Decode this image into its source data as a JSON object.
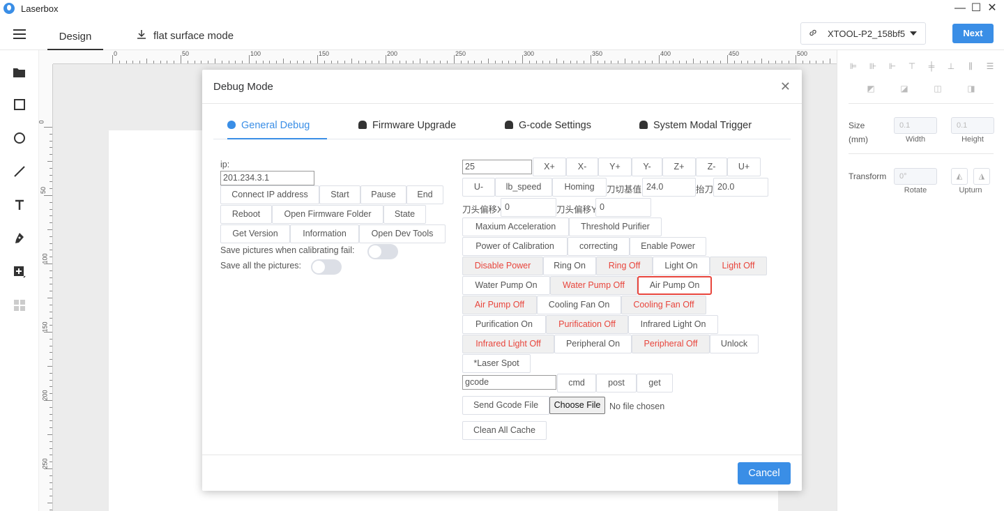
{
  "app": {
    "title": "Laserbox"
  },
  "window_controls": {
    "minimize": "—",
    "maximize": "☐",
    "close": "✕"
  },
  "topbar": {
    "tabs": [
      {
        "label": "Design"
      },
      {
        "label": "flat surface mode"
      }
    ],
    "device": {
      "name": "XTOOL-P2_158bf5"
    },
    "next_label": "Next"
  },
  "ruler": {
    "top_marks": [
      "0",
      "50",
      "100",
      "150",
      "200",
      "250",
      "300",
      "350",
      "400",
      "450",
      "500"
    ],
    "left_marks": [
      "0",
      "50",
      "100",
      "150",
      "200",
      "250"
    ]
  },
  "right_panel": {
    "size_label": "Size",
    "size_unit": "(mm)",
    "width_value": "0.1",
    "width_label": "Width",
    "height_value": "0.1",
    "height_label": "Height",
    "transform_label": "Transform",
    "rotate_value": "0°",
    "rotate_label": "Rotate",
    "upturn_label": "Upturn"
  },
  "dialog": {
    "title": "Debug Mode",
    "tabs": [
      {
        "label": "General Debug",
        "icon": "apple-icon"
      },
      {
        "label": "Firmware Upgrade",
        "icon": "android-icon"
      },
      {
        "label": "G-code Settings",
        "icon": "android-icon"
      },
      {
        "label": "System Modal Trigger",
        "icon": "android-icon"
      }
    ],
    "left": {
      "ip_label": "ip:",
      "ip_value": "201.234.3.1",
      "buttons_row1": [
        "Connect IP address",
        "Start",
        "Pause",
        "End"
      ],
      "buttons_row2": [
        "Reboot",
        "Open Firmware Folder",
        "State"
      ],
      "buttons_row3": [
        "Get Version",
        "Information",
        "Open Dev Tools"
      ],
      "save_fail_label": "Save pictures when calibrating fail:",
      "save_all_label": "Save all the pictures:"
    },
    "right": {
      "step_value": "25",
      "axis_buttons": [
        "X+",
        "X-",
        "Y+",
        "Y-",
        "Z+",
        "Z-",
        "U+"
      ],
      "row2": {
        "u_minus": "U-",
        "lb_speed": "lb_speed",
        "homing": "Homing",
        "cut_base_label": "刀切基值",
        "cut_base_value": "24.0",
        "lift_label": "抬刀",
        "lift_value": "20.0"
      },
      "offset": {
        "x_label": "刀头偏移X",
        "x_value": "0",
        "y_label": "刀头偏移Y",
        "y_value": "0"
      },
      "buttons": {
        "max_accel": "Maxium Acceleration",
        "threshold_purifier": "Threshold Purifier",
        "power_calibration": "Power of Calibration",
        "correcting": "correcting",
        "enable_power": "Enable Power",
        "disable_power": "Disable Power",
        "ring_on": "Ring On",
        "ring_off": "Ring Off",
        "light_on": "Light On",
        "light_off": "Light Off",
        "water_pump_on": "Water Pump On",
        "water_pump_off": "Water Pump Off",
        "air_pump_on": "Air Pump On",
        "air_pump_off": "Air Pump Off",
        "cooling_fan_on": "Cooling Fan On",
        "cooling_fan_off": "Cooling Fan Off",
        "purification_on": "Purification On",
        "purification_off": "Purification Off",
        "infrared_light_on": "Infrared Light On",
        "infrared_light_off": "Infrared Light Off",
        "peripheral_on": "Peripheral On",
        "peripheral_off": "Peripheral Off",
        "unlock": "Unlock",
        "laser_spot": "*Laser Spot"
      },
      "gcode_value": "gcode",
      "cmd": "cmd",
      "post": "post",
      "get": "get",
      "send_gcode": "Send Gcode File",
      "choose_file": "Choose File",
      "no_file": "No file chosen",
      "clean_cache": "Clean All Cache"
    },
    "cancel_label": "Cancel"
  },
  "colors": {
    "accent": "#3a8ee6",
    "danger": "#e8453c"
  }
}
